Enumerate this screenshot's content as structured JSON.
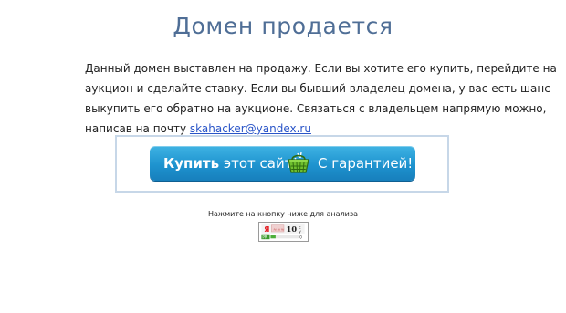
{
  "page": {
    "title": "Домен продается"
  },
  "description": {
    "line1": "Данный домен выставлен на продажу. Если вы хотите его купить, перейдите на",
    "line2": "аукцион и сделайте ставку. Если вы бывший владелец домена, у вас есть шанс",
    "line3": "выкупить его обратно на аукционе. Связаться с владельцем напрямую можно,",
    "line4_prefix": "написав на почту",
    "email": "skahacker@yandex.ru"
  },
  "buy_button": {
    "label_bold": "Купить",
    "label_rest": "этот сайт!",
    "label_right": "С гарантией!",
    "icon": "basket-icon"
  },
  "analysis": {
    "hint": "Нажмите на кнопку ниже для анализа",
    "counter_value": "10",
    "counter_letter": "Я",
    "icon": "yandex-tic-counter-icon"
  },
  "colors": {
    "title": "#4f6e96",
    "link": "#2a55c8",
    "button": "#1e93cf",
    "frame_border": "#c7d7e8"
  }
}
